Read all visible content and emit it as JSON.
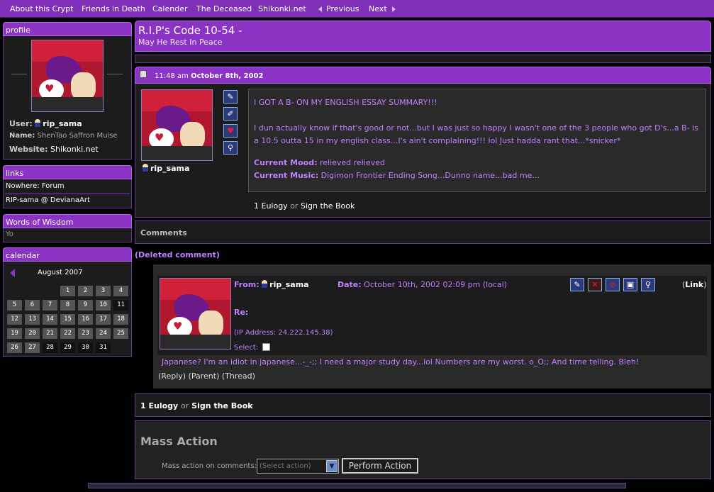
{
  "nav": {
    "items": [
      "About this Crypt",
      "Friends in Death",
      "Calender",
      "The Deceased",
      "Shikonki.net"
    ],
    "previous": "Previous",
    "next": "Next"
  },
  "profile": {
    "title": "profile",
    "user_label": "User:",
    "user": "rip_sama",
    "name_label": "Name:",
    "name": "ShenTao Saffron Muise",
    "website_label": "Website:",
    "website": "Shikonki.net"
  },
  "links": {
    "title": "links",
    "items": [
      "Nowhere: Forum",
      "RIP-sama @ DevianaArt"
    ]
  },
  "wisdom": {
    "title": "Words of Wisdom",
    "text": "Yo"
  },
  "calendar": {
    "title": "calendar",
    "month": "August 2007",
    "days": [
      "1",
      "2",
      "3",
      "4",
      "5",
      "6",
      "7",
      "8",
      "9",
      "10",
      "11",
      "12",
      "13",
      "14",
      "15",
      "16",
      "17",
      "18",
      "19",
      "20",
      "21",
      "22",
      "23",
      "24",
      "25",
      "26",
      "27",
      "28",
      "29",
      "30",
      "31"
    ]
  },
  "header": {
    "title": "R.I.P's Code 10-54 -",
    "subtitle": "May He Rest In Peace"
  },
  "entry": {
    "time": "11:48 am",
    "date": "October 8th, 2002",
    "username": "rip_sama",
    "text1": "I GOT A B- ON MY ENGLISH ESSAY SUMMARY!!!",
    "text2": "I dun actually know if that's good or not...but I was just so happy I wasn't one of the 3 people who got D's...a B- is a 10.5 outta 15 in my english class...I's ain't complaining!!! lol Just hadda rant that...*snicker*",
    "mood_label": "Current Mood:",
    "mood": "relieved relieved",
    "music_label": "Current Music:",
    "music": "Digimon Frontier Ending Song...Dunno name...bad me...",
    "eulogy": "1 Eulogy",
    "or": "or",
    "sign": "Sign the Book"
  },
  "comments": {
    "title": "Comments",
    "deleted": "(Deleted comment)",
    "from_label": "From:",
    "from": "rip_sama",
    "date_label": "Date:",
    "date": "October 10th, 2002 02:09 pm (local)",
    "link_open": "(",
    "link": "Link",
    "link_close": ")",
    "re": "Re:",
    "ip": "(IP Address: 24.222.145.38)",
    "select": "Select:",
    "text": "Japanese? I'm an idiot in japanese...-_-;; I need a major study day...lol Numbers are my worst. o_O;; And time telling. Bleh!",
    "reply": "Reply",
    "parent": "Parent",
    "thread": "Thread"
  },
  "bottom": {
    "eulogy": "1 Eulogy",
    "or": "or",
    "sign": "Sign the Book"
  },
  "mass": {
    "title": "Mass Action",
    "label": "Mass action on comments:",
    "select_placeholder": "(Select action)",
    "button": "Perform Action"
  },
  "colors": {
    "accent": "#8a33c4",
    "link_purple": "#c080ff",
    "panel": "#1c1c1c"
  }
}
